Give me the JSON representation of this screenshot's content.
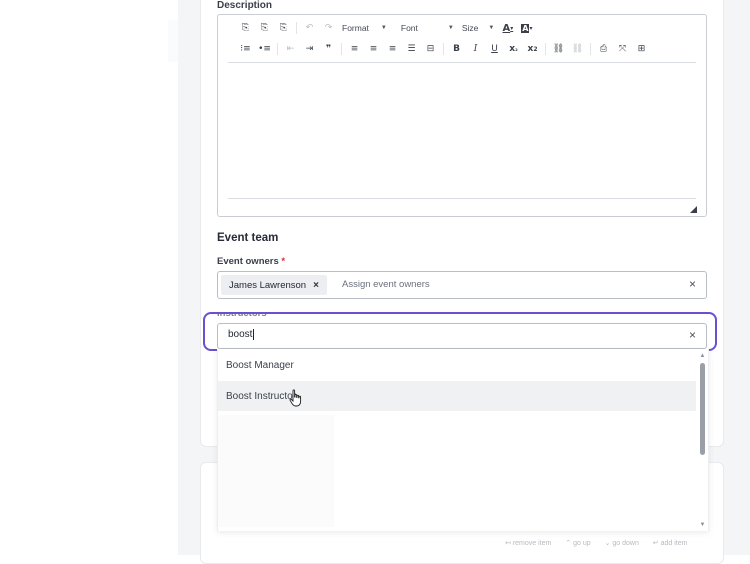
{
  "description": {
    "label": "Description"
  },
  "editor": {
    "row1": [
      "paste-icon",
      "paste-text-icon",
      "paste-word-icon",
      "undo-icon",
      "redo-icon"
    ],
    "format_label": "Format",
    "font_label": "Font",
    "size_label": "Size",
    "text_color_glyph": "A",
    "bg_color_glyph": "A"
  },
  "event_team": {
    "title": "Event team",
    "owners_label": "Event owners",
    "owners_required": "*",
    "owner_chip": "James Lawrenson",
    "owner_chip_remove": "×",
    "owners_placeholder": "Assign event owners",
    "owners_clear": "×",
    "instructors_label": "Instructors",
    "instructors_value": "boost",
    "instructors_clear": "×"
  },
  "dropdown": {
    "options": [
      "Boost Manager",
      "Boost Instructor"
    ],
    "hovered_index": 1
  },
  "hints": [
    "remove item",
    "go up",
    "go down",
    "add item"
  ],
  "colors": {
    "focus": "#6a4fd0",
    "required": "#d4322f"
  }
}
